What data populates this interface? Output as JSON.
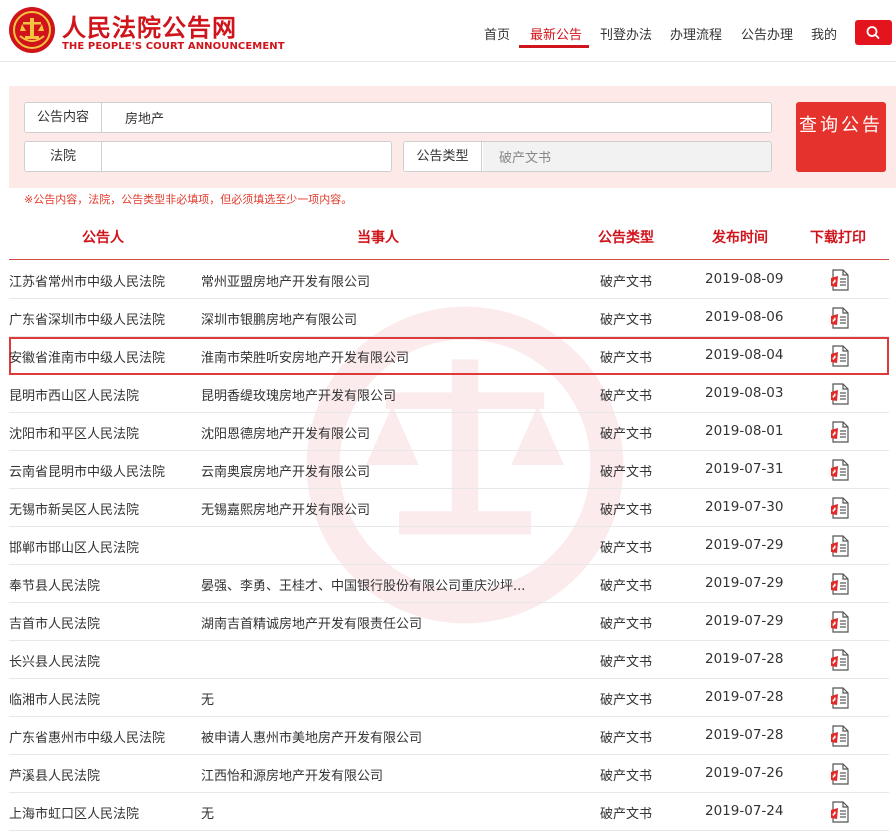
{
  "header": {
    "site_name_cn": "人民法院公告网",
    "site_name_en": "THE PEOPLE'S COURT ANNOUNCEMENT",
    "nav": [
      {
        "label": "首页",
        "active": false
      },
      {
        "label": "最新公告",
        "active": true
      },
      {
        "label": "刊登办法",
        "active": false
      },
      {
        "label": "办理流程",
        "active": false
      },
      {
        "label": "公告办理",
        "active": false
      },
      {
        "label": "我的",
        "active": false
      }
    ],
    "search_icon": "search-icon"
  },
  "query": {
    "content_label": "公告内容",
    "content_value": "房地产",
    "court_label": "法院",
    "court_value": "",
    "type_label": "公告类型",
    "type_value": "破产文书",
    "button_label": "查询公告",
    "hint": "※公告内容，法院，公告类型非必填项，但必须填选至少一项内容。"
  },
  "table": {
    "headers": {
      "court": "公告人",
      "party": "当事人",
      "type": "公告类型",
      "date": "发布时间",
      "download": "下载打印"
    },
    "rows": [
      {
        "court": "江苏省常州市中级人民法院",
        "party": "常州亚盟房地产开发有限公司",
        "type": "破产文书",
        "date": "2019-08-09"
      },
      {
        "court": "广东省深圳市中级人民法院",
        "party": "深圳市银鹏房地产有限公司",
        "type": "破产文书",
        "date": "2019-08-06"
      },
      {
        "court": "安徽省淮南市中级人民法院",
        "party": "淮南市荣胜听安房地产开发有限公司",
        "type": "破产文书",
        "date": "2019-08-04",
        "highlight": true
      },
      {
        "court": "昆明市西山区人民法院",
        "party": "昆明香缇玫瑰房地产开发有限公司",
        "type": "破产文书",
        "date": "2019-08-03"
      },
      {
        "court": "沈阳市和平区人民法院",
        "party": "沈阳恩德房地产开发有限公司",
        "type": "破产文书",
        "date": "2019-08-01"
      },
      {
        "court": "云南省昆明市中级人民法院",
        "party": "云南奥宸房地产开发有限公司",
        "type": "破产文书",
        "date": "2019-07-31"
      },
      {
        "court": "无锡市新吴区人民法院",
        "party": "无锡嘉熙房地产开发有限公司",
        "type": "破产文书",
        "date": "2019-07-30"
      },
      {
        "court": "邯郸市邯山区人民法院",
        "party": "",
        "type": "破产文书",
        "date": "2019-07-29"
      },
      {
        "court": "奉节县人民法院",
        "party": "晏强、李勇、王桂才、中国银行股份有限公司重庆沙坪...",
        "type": "破产文书",
        "date": "2019-07-29"
      },
      {
        "court": "吉首市人民法院",
        "party": "湖南吉首精诚房地产开发有限责任公司",
        "type": "破产文书",
        "date": "2019-07-29"
      },
      {
        "court": "长兴县人民法院",
        "party": "",
        "type": "破产文书",
        "date": "2019-07-28"
      },
      {
        "court": "临湘市人民法院",
        "party": "无",
        "type": "破产文书",
        "date": "2019-07-28"
      },
      {
        "court": "广东省惠州市中级人民法院",
        "party": "被申请人惠州市美地房产开发有限公司",
        "type": "破产文书",
        "date": "2019-07-28"
      },
      {
        "court": "芦溪县人民法院",
        "party": "江西怡和源房地产开发有限公司",
        "type": "破产文书",
        "date": "2019-07-26"
      },
      {
        "court": "上海市虹口区人民法院",
        "party": "无",
        "type": "破产文书",
        "date": "2019-07-24"
      }
    ],
    "download_icon": "pdf-icon"
  },
  "colors": {
    "brand_red": "#d0141b",
    "panel_bg": "#fde9e7",
    "button_red": "#e5322d"
  }
}
